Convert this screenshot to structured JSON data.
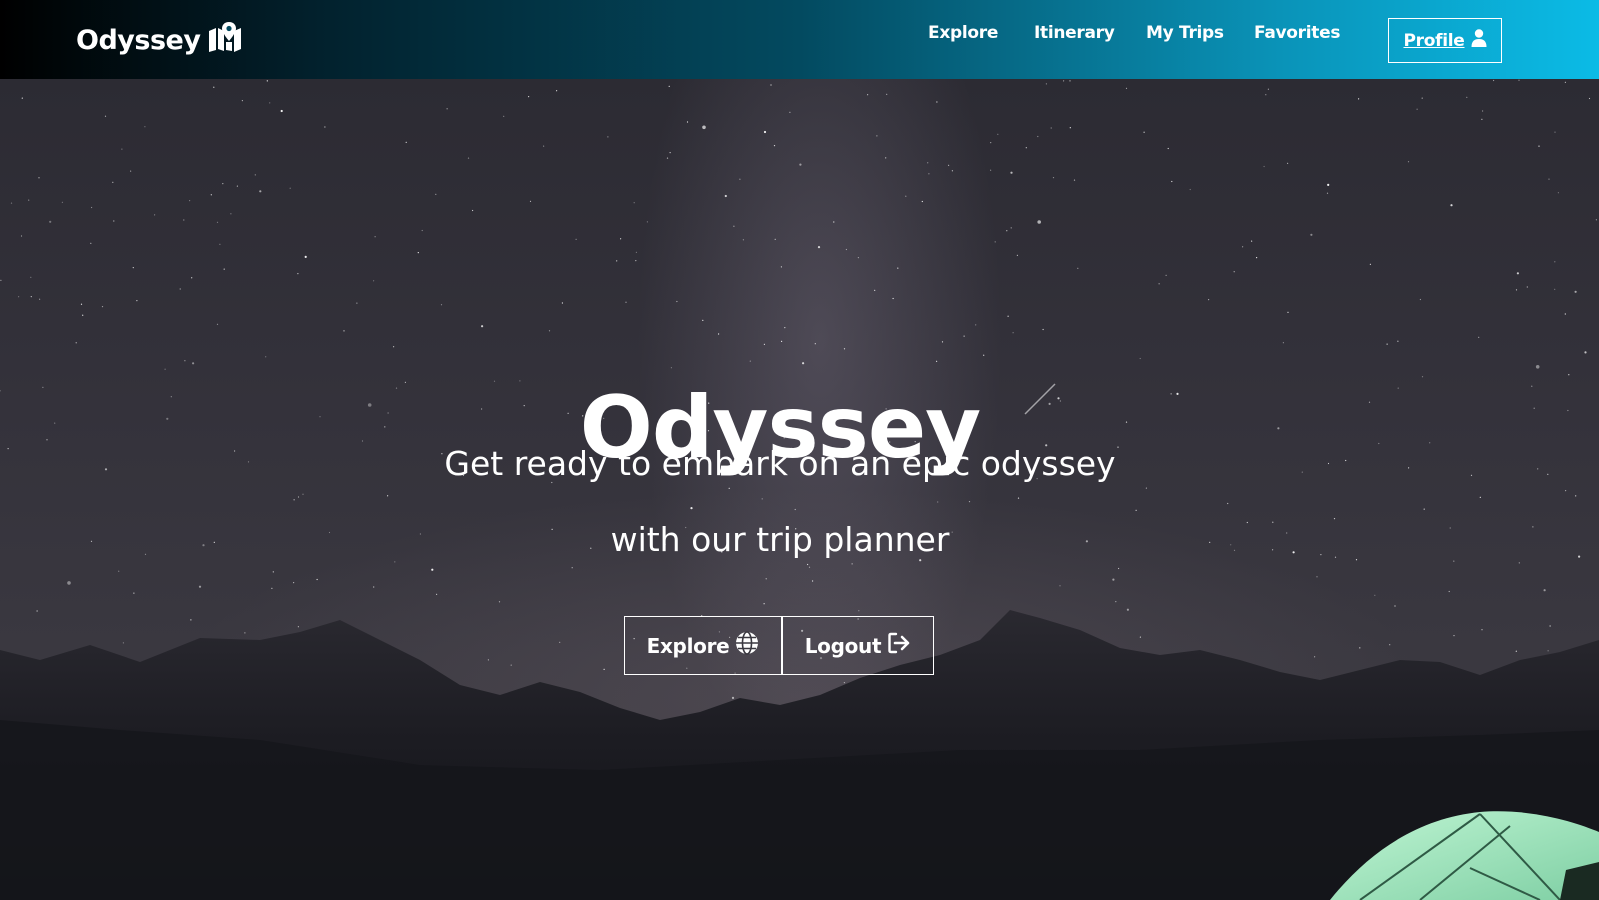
{
  "navbar": {
    "brand": "Odyssey",
    "brand_icon": "map-location-icon",
    "links": [
      {
        "label": "Explore"
      },
      {
        "label": "Itinerary"
      },
      {
        "label": "My Trips"
      },
      {
        "label": "Favorites"
      }
    ],
    "profile_label": "Profile",
    "profile_icon": "user-icon"
  },
  "hero": {
    "title": "Odyssey",
    "subtitle_line1": "Get ready to embark on an epic odyssey",
    "subtitle_line2": "with our trip planner",
    "explore_label": "Explore",
    "explore_icon": "globe-icon",
    "logout_label": "Logout",
    "logout_icon": "sign-out-icon"
  },
  "colors": {
    "nav_gradient_start": "#000000",
    "nav_gradient_end": "#0bbbe6",
    "text": "#ffffff",
    "tent": "#9fe0bd"
  }
}
